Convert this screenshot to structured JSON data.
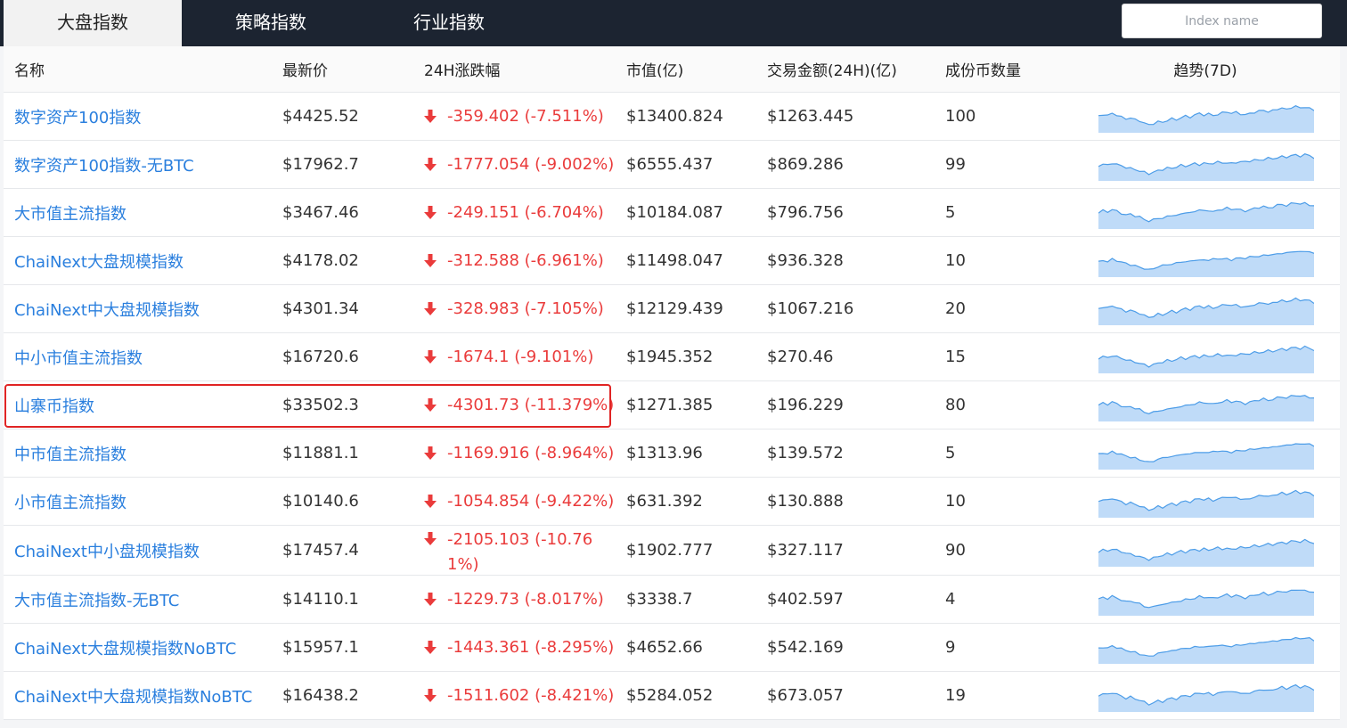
{
  "tabs": [
    {
      "label": "大盘指数",
      "active": true
    },
    {
      "label": "策略指数",
      "active": false
    },
    {
      "label": "行业指数",
      "active": false
    }
  ],
  "search": {
    "placeholder": "Index name"
  },
  "colors": {
    "link": "#2a7fde",
    "down": "#ea3b3b",
    "spark_line": "#4d9de8",
    "spark_fill": "#a9cff5",
    "highlight": "#e02424"
  },
  "table": {
    "headers": {
      "name": "名称",
      "price": "最新价",
      "change": "24H涨跌幅",
      "mcap": "市值(亿)",
      "volume": "交易金额(24H)(亿)",
      "count": "成份币数量",
      "trend": "趋势(7D)"
    },
    "rows": [
      {
        "name": "数字资产100指数",
        "price": "$4425.52",
        "change": "-359.402 (-7.511%)",
        "mcap": "$13400.824",
        "volume": "$1263.445",
        "count": "100",
        "highlighted": false
      },
      {
        "name": "数字资产100指数-无BTC",
        "price": "$17962.7",
        "change": "-1777.054 (-9.002%)",
        "mcap": "$6555.437",
        "volume": "$869.286",
        "count": "99",
        "highlighted": false
      },
      {
        "name": "大市值主流指数",
        "price": "$3467.46",
        "change": "-249.151 (-6.704%)",
        "mcap": "$10184.087",
        "volume": "$796.756",
        "count": "5",
        "highlighted": false
      },
      {
        "name": "ChaiNext大盘规模指数",
        "price": "$4178.02",
        "change": "-312.588 (-6.961%)",
        "mcap": "$11498.047",
        "volume": "$936.328",
        "count": "10",
        "highlighted": false
      },
      {
        "name": "ChaiNext中大盘规模指数",
        "price": "$4301.34",
        "change": "-328.983 (-7.105%)",
        "mcap": "$12129.439",
        "volume": "$1067.216",
        "count": "20",
        "highlighted": false
      },
      {
        "name": "中小市值主流指数",
        "price": "$16720.6",
        "change": "-1674.1 (-9.101%)",
        "mcap": "$1945.352",
        "volume": "$270.46",
        "count": "15",
        "highlighted": false
      },
      {
        "name": "山寨币指数",
        "price": "$33502.3",
        "change": "-4301.73 (-11.379%)",
        "mcap": "$1271.385",
        "volume": "$196.229",
        "count": "80",
        "highlighted": true
      },
      {
        "name": "中市值主流指数",
        "price": "$11881.1",
        "change": "-1169.916 (-8.964%)",
        "mcap": "$1313.96",
        "volume": "$139.572",
        "count": "5",
        "highlighted": false
      },
      {
        "name": "小市值主流指数",
        "price": "$10140.6",
        "change": "-1054.854 (-9.422%)",
        "mcap": "$631.392",
        "volume": "$130.888",
        "count": "10",
        "highlighted": false
      },
      {
        "name": "ChaiNext中小盘规模指数",
        "price": "$17457.4",
        "change": "-2105.103 (-10.761%)",
        "mcap": "$1902.777",
        "volume": "$327.117",
        "count": "90",
        "highlighted": false
      },
      {
        "name": "大市值主流指数-无BTC",
        "price": "$14110.1",
        "change": "-1229.73 (-8.017%)",
        "mcap": "$3338.7",
        "volume": "$402.597",
        "count": "4",
        "highlighted": false
      },
      {
        "name": "ChaiNext大盘规模指数NoBTC",
        "price": "$15957.1",
        "change": "-1443.361 (-8.295%)",
        "mcap": "$4652.66",
        "volume": "$542.169",
        "count": "9",
        "highlighted": false
      },
      {
        "name": "ChaiNext中大盘规模指数NoBTC",
        "price": "$16438.2",
        "change": "-1511.602 (-8.421%)",
        "mcap": "$5284.052",
        "volume": "$673.057",
        "count": "19",
        "highlighted": false
      }
    ]
  },
  "trend_7d": {
    "shape": [
      0.55,
      0.62,
      0.58,
      0.66,
      0.6,
      0.52,
      0.45,
      0.5,
      0.42,
      0.38,
      0.3,
      0.22,
      0.28,
      0.35,
      0.32,
      0.4,
      0.46,
      0.42,
      0.5,
      0.56,
      0.52,
      0.6,
      0.66,
      0.6,
      0.64,
      0.58,
      0.62,
      0.68,
      0.72,
      0.66,
      0.7,
      0.64,
      0.6,
      0.66,
      0.7,
      0.74,
      0.78,
      0.72,
      0.76,
      0.82,
      0.86,
      0.8,
      0.88,
      0.92,
      0.86,
      0.9,
      0.84,
      0.78
    ],
    "shape_alt": [
      0.5,
      0.56,
      0.52,
      0.6,
      0.55,
      0.5,
      0.44,
      0.4,
      0.36,
      0.3,
      0.26,
      0.2,
      0.26,
      0.32,
      0.36,
      0.42,
      0.4,
      0.46,
      0.52,
      0.48,
      0.54,
      0.58,
      0.54,
      0.6,
      0.56,
      0.6,
      0.64,
      0.6,
      0.62,
      0.58,
      0.62,
      0.66,
      0.64,
      0.68,
      0.72,
      0.7,
      0.74,
      0.78,
      0.76,
      0.8,
      0.84,
      0.82,
      0.88,
      0.9,
      0.86,
      0.92,
      0.88,
      0.8
    ]
  }
}
